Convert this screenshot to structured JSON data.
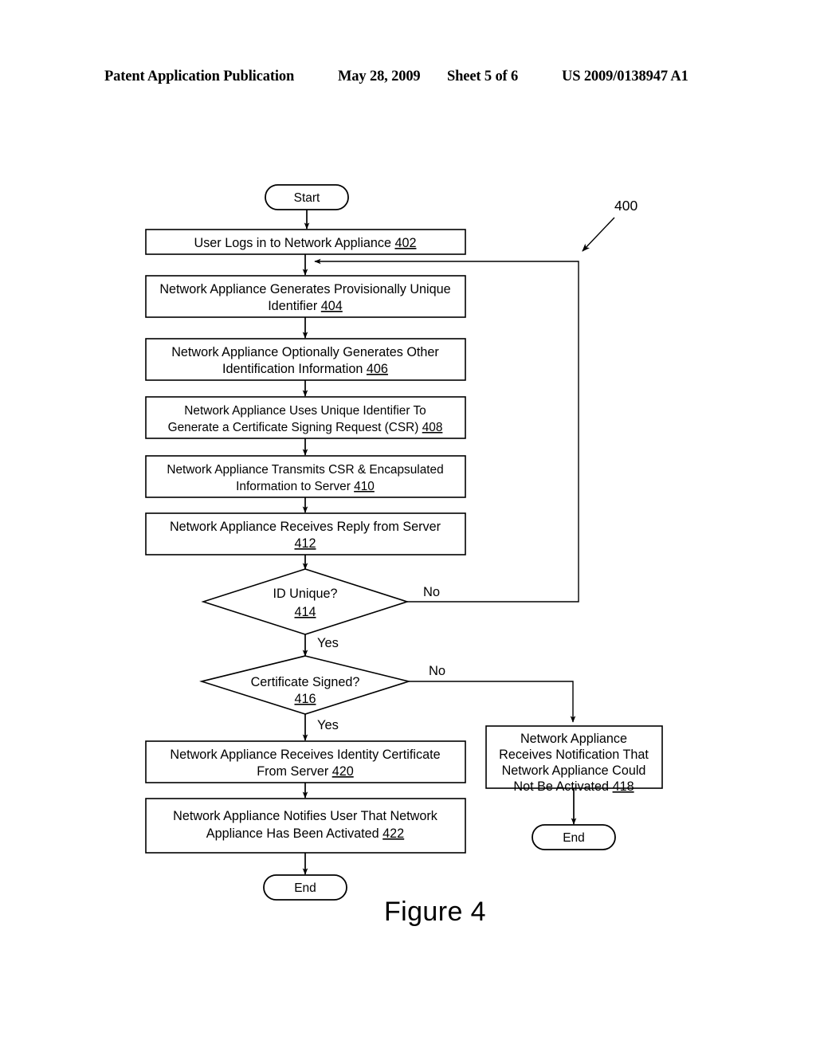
{
  "header": {
    "publication": "Patent Application Publication",
    "date": "May 28, 2009",
    "sheet": "Sheet 5 of 6",
    "patent_number": "US 2009/0138947 A1"
  },
  "figure": {
    "caption": "Figure 4",
    "diagram_reference": "400"
  },
  "nodes": {
    "start": {
      "label": "Start"
    },
    "step_402": {
      "line1": "User Logs in to Network Appliance",
      "ref": "402"
    },
    "step_404": {
      "line1": "Network Appliance Generates Provisionally Unique",
      "line2": "Identifier",
      "ref": "404"
    },
    "step_406": {
      "line1": "Network Appliance Optionally Generates Other",
      "line2": "Identification Information",
      "ref": "406"
    },
    "step_408": {
      "line1": "Network Appliance Uses Unique Identifier To",
      "line2": "Generate a Certificate Signing Request (CSR)",
      "ref": "408"
    },
    "step_410": {
      "line1": "Network Appliance Transmits CSR & Encapsulated",
      "line2": "Information to Server",
      "ref": "410"
    },
    "step_412": {
      "line1": "Network Appliance Receives Reply from Server",
      "line2": "",
      "ref": "412"
    },
    "decision_414": {
      "label": "ID Unique?",
      "ref": "414"
    },
    "decision_416": {
      "label": "Certificate Signed?",
      "ref": "416"
    },
    "step_418": {
      "line1": "Network Appliance",
      "line2": "Receives Notification That",
      "line3": "Network Appliance Could",
      "line4": "Not Be Activated",
      "ref": "418"
    },
    "step_420": {
      "line1": "Network Appliance Receives Identity Certificate",
      "line2": "From Server",
      "ref": "420"
    },
    "step_422": {
      "line1": "Network Appliance Notifies User That Network",
      "line2": "Appliance Has Been Activated",
      "ref": "422"
    },
    "end_main": {
      "label": "End"
    },
    "end_fail": {
      "label": "End"
    }
  },
  "branch_labels": {
    "unique_no": "No",
    "unique_yes": "Yes",
    "signed_no": "No",
    "signed_yes": "Yes"
  },
  "colors": {
    "ink": "#000000",
    "paper": "#ffffff"
  }
}
